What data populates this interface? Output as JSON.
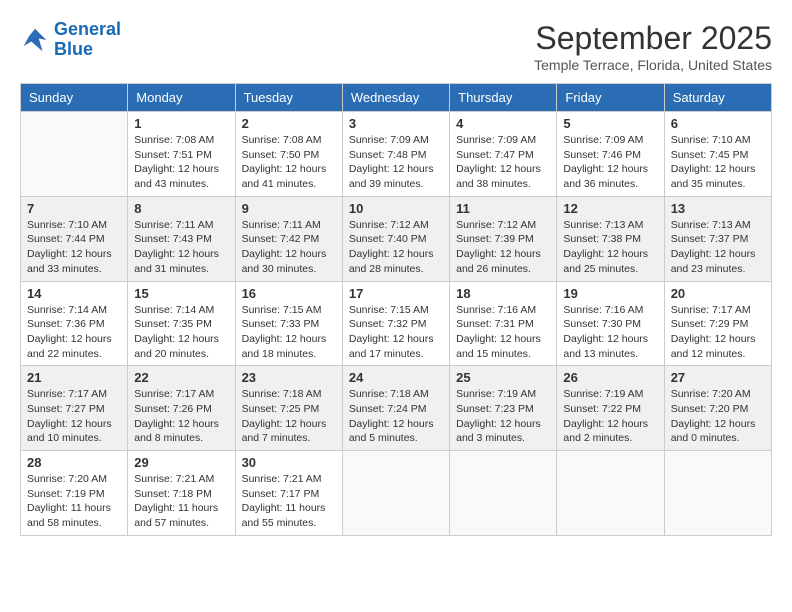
{
  "header": {
    "logo_line1": "General",
    "logo_line2": "Blue",
    "month": "September 2025",
    "location": "Temple Terrace, Florida, United States"
  },
  "days_of_week": [
    "Sunday",
    "Monday",
    "Tuesday",
    "Wednesday",
    "Thursday",
    "Friday",
    "Saturday"
  ],
  "weeks": [
    [
      {
        "day": "",
        "info": ""
      },
      {
        "day": "1",
        "info": "Sunrise: 7:08 AM\nSunset: 7:51 PM\nDaylight: 12 hours\nand 43 minutes."
      },
      {
        "day": "2",
        "info": "Sunrise: 7:08 AM\nSunset: 7:50 PM\nDaylight: 12 hours\nand 41 minutes."
      },
      {
        "day": "3",
        "info": "Sunrise: 7:09 AM\nSunset: 7:48 PM\nDaylight: 12 hours\nand 39 minutes."
      },
      {
        "day": "4",
        "info": "Sunrise: 7:09 AM\nSunset: 7:47 PM\nDaylight: 12 hours\nand 38 minutes."
      },
      {
        "day": "5",
        "info": "Sunrise: 7:09 AM\nSunset: 7:46 PM\nDaylight: 12 hours\nand 36 minutes."
      },
      {
        "day": "6",
        "info": "Sunrise: 7:10 AM\nSunset: 7:45 PM\nDaylight: 12 hours\nand 35 minutes."
      }
    ],
    [
      {
        "day": "7",
        "info": "Sunrise: 7:10 AM\nSunset: 7:44 PM\nDaylight: 12 hours\nand 33 minutes."
      },
      {
        "day": "8",
        "info": "Sunrise: 7:11 AM\nSunset: 7:43 PM\nDaylight: 12 hours\nand 31 minutes."
      },
      {
        "day": "9",
        "info": "Sunrise: 7:11 AM\nSunset: 7:42 PM\nDaylight: 12 hours\nand 30 minutes."
      },
      {
        "day": "10",
        "info": "Sunrise: 7:12 AM\nSunset: 7:40 PM\nDaylight: 12 hours\nand 28 minutes."
      },
      {
        "day": "11",
        "info": "Sunrise: 7:12 AM\nSunset: 7:39 PM\nDaylight: 12 hours\nand 26 minutes."
      },
      {
        "day": "12",
        "info": "Sunrise: 7:13 AM\nSunset: 7:38 PM\nDaylight: 12 hours\nand 25 minutes."
      },
      {
        "day": "13",
        "info": "Sunrise: 7:13 AM\nSunset: 7:37 PM\nDaylight: 12 hours\nand 23 minutes."
      }
    ],
    [
      {
        "day": "14",
        "info": "Sunrise: 7:14 AM\nSunset: 7:36 PM\nDaylight: 12 hours\nand 22 minutes."
      },
      {
        "day": "15",
        "info": "Sunrise: 7:14 AM\nSunset: 7:35 PM\nDaylight: 12 hours\nand 20 minutes."
      },
      {
        "day": "16",
        "info": "Sunrise: 7:15 AM\nSunset: 7:33 PM\nDaylight: 12 hours\nand 18 minutes."
      },
      {
        "day": "17",
        "info": "Sunrise: 7:15 AM\nSunset: 7:32 PM\nDaylight: 12 hours\nand 17 minutes."
      },
      {
        "day": "18",
        "info": "Sunrise: 7:16 AM\nSunset: 7:31 PM\nDaylight: 12 hours\nand 15 minutes."
      },
      {
        "day": "19",
        "info": "Sunrise: 7:16 AM\nSunset: 7:30 PM\nDaylight: 12 hours\nand 13 minutes."
      },
      {
        "day": "20",
        "info": "Sunrise: 7:17 AM\nSunset: 7:29 PM\nDaylight: 12 hours\nand 12 minutes."
      }
    ],
    [
      {
        "day": "21",
        "info": "Sunrise: 7:17 AM\nSunset: 7:27 PM\nDaylight: 12 hours\nand 10 minutes."
      },
      {
        "day": "22",
        "info": "Sunrise: 7:17 AM\nSunset: 7:26 PM\nDaylight: 12 hours\nand 8 minutes."
      },
      {
        "day": "23",
        "info": "Sunrise: 7:18 AM\nSunset: 7:25 PM\nDaylight: 12 hours\nand 7 minutes."
      },
      {
        "day": "24",
        "info": "Sunrise: 7:18 AM\nSunset: 7:24 PM\nDaylight: 12 hours\nand 5 minutes."
      },
      {
        "day": "25",
        "info": "Sunrise: 7:19 AM\nSunset: 7:23 PM\nDaylight: 12 hours\nand 3 minutes."
      },
      {
        "day": "26",
        "info": "Sunrise: 7:19 AM\nSunset: 7:22 PM\nDaylight: 12 hours\nand 2 minutes."
      },
      {
        "day": "27",
        "info": "Sunrise: 7:20 AM\nSunset: 7:20 PM\nDaylight: 12 hours\nand 0 minutes."
      }
    ],
    [
      {
        "day": "28",
        "info": "Sunrise: 7:20 AM\nSunset: 7:19 PM\nDaylight: 11 hours\nand 58 minutes."
      },
      {
        "day": "29",
        "info": "Sunrise: 7:21 AM\nSunset: 7:18 PM\nDaylight: 11 hours\nand 57 minutes."
      },
      {
        "day": "30",
        "info": "Sunrise: 7:21 AM\nSunset: 7:17 PM\nDaylight: 11 hours\nand 55 minutes."
      },
      {
        "day": "",
        "info": ""
      },
      {
        "day": "",
        "info": ""
      },
      {
        "day": "",
        "info": ""
      },
      {
        "day": "",
        "info": ""
      }
    ]
  ]
}
